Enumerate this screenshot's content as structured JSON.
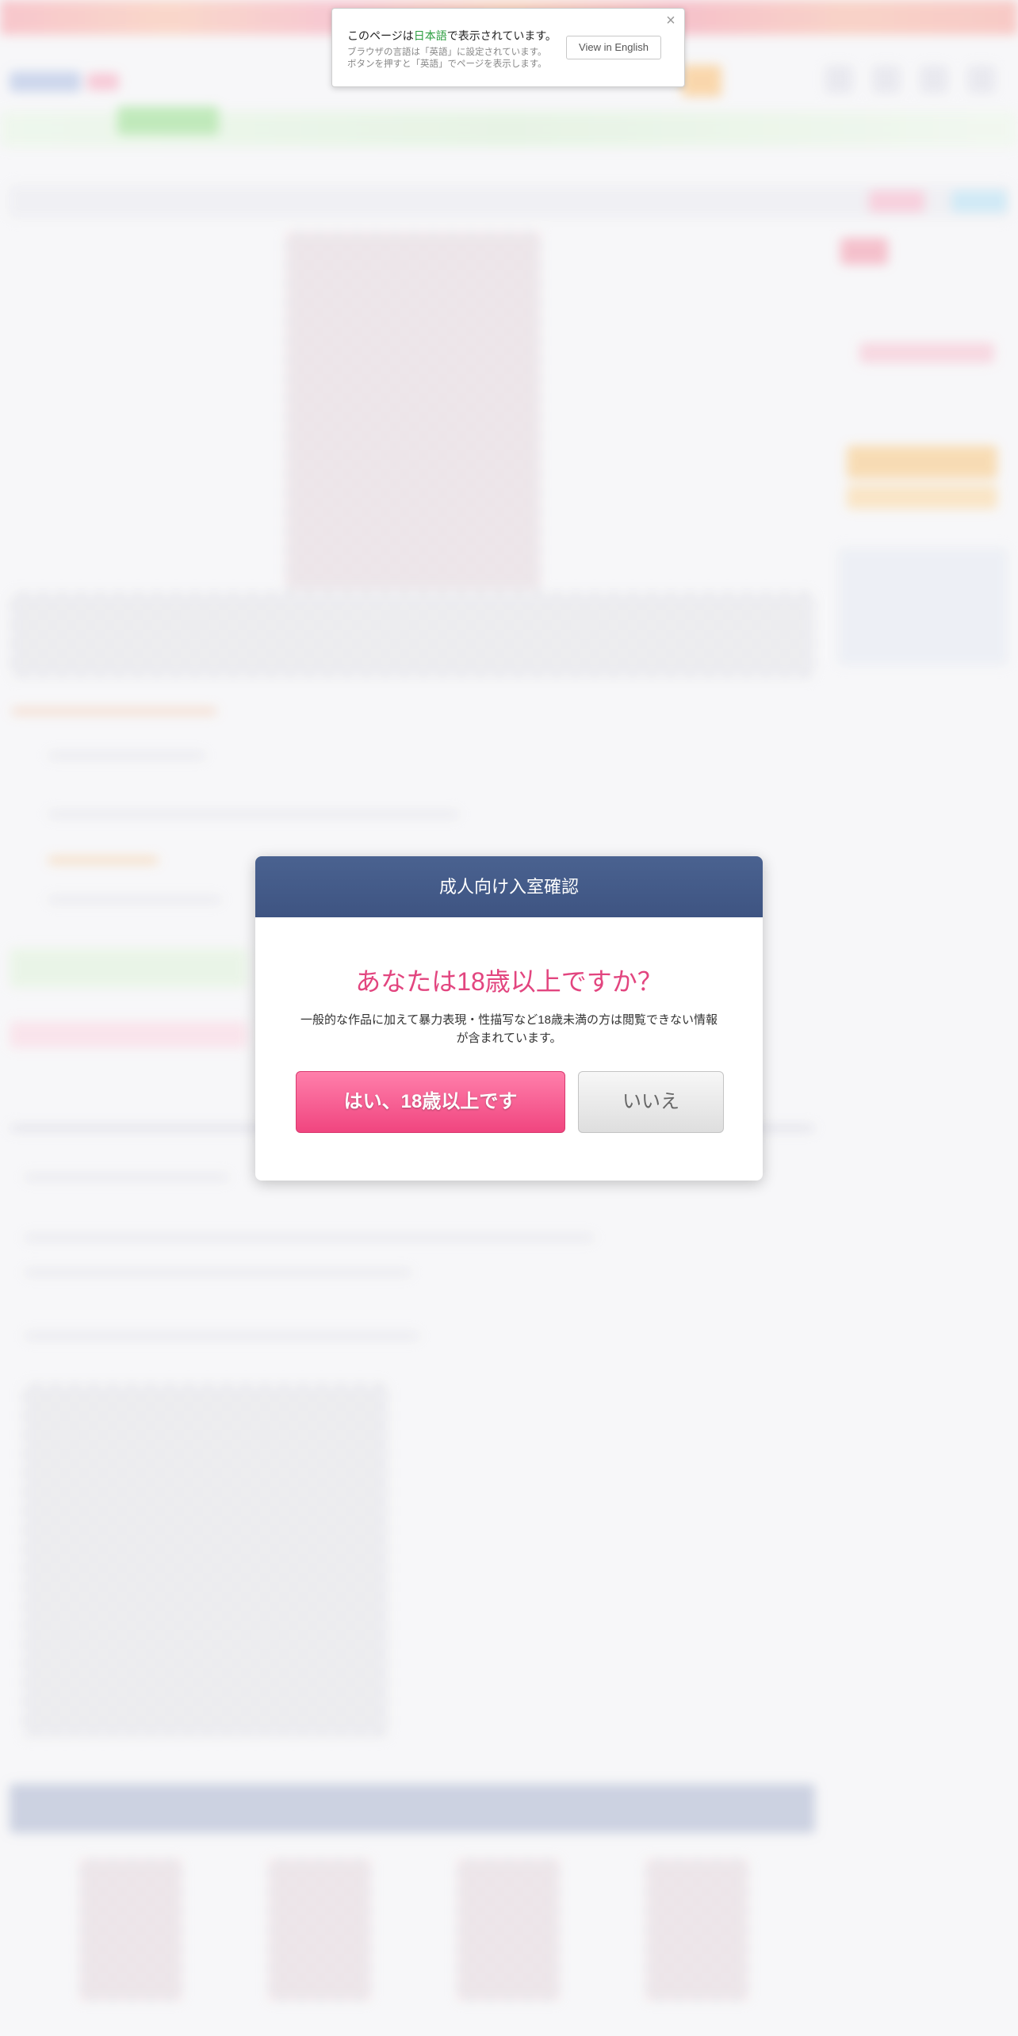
{
  "language_notice": {
    "message_prefix": "このページは",
    "language_name": "日本語",
    "message_suffix": "で表示されています。",
    "sub_line1": "ブラウザの言語は「英語」に設定されています。",
    "sub_line2": "ボタンを押すと「英語」でページを表示します。",
    "button_label": "View in English",
    "close_glyph": "×"
  },
  "age_modal": {
    "title": "成人向け入室確認",
    "question": "あなたは18歳以上ですか？",
    "description": "一般的な作品に加えて暴力表現・性描写など18歳未満の方は閲覧できない情報が含まれています。",
    "yes_label": "はい、18歳以上です",
    "no_label": "いいえ"
  },
  "colors": {
    "modal_header": "#445b8a",
    "accent_pink": "#e2457f",
    "yes_button": "#f0457f",
    "language_green": "#2a9d3e"
  }
}
